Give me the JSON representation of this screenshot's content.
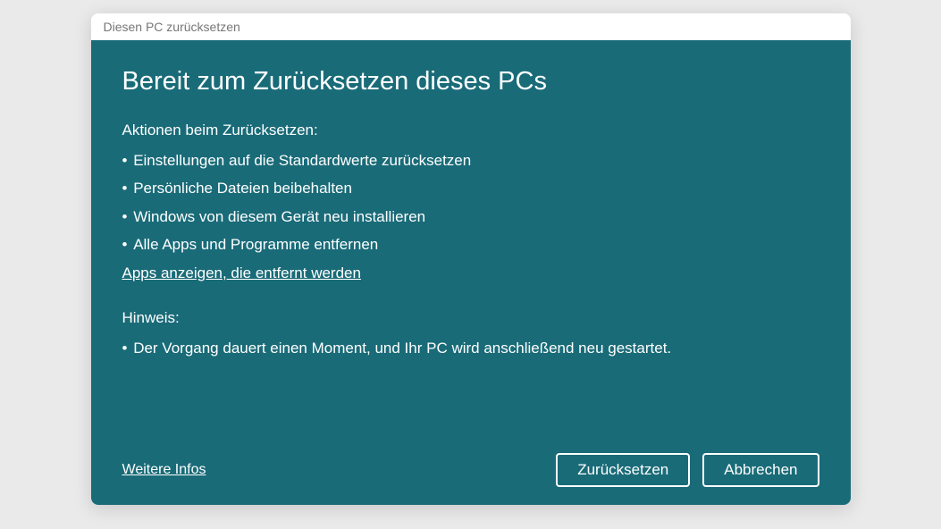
{
  "titlebar": "Diesen PC zurücksetzen",
  "heading": "Bereit zum Zurücksetzen dieses PCs",
  "actions": {
    "label": "Aktionen beim Zurücksetzen:",
    "items": [
      "Einstellungen auf die Standardwerte zurücksetzen",
      "Persönliche Dateien beibehalten",
      " Windows von diesem Gerät neu installieren",
      "Alle Apps und Programme entfernen"
    ]
  },
  "apps_link": "Apps anzeigen, die entfernt werden",
  "note": {
    "label": "Hinweis:",
    "items": [
      " Der Vorgang dauert einen Moment, und Ihr PC wird anschließend neu gestartet."
    ]
  },
  "footer": {
    "more_info": "Weitere Infos",
    "reset": "Zurücksetzen",
    "cancel": "Abbrechen"
  }
}
